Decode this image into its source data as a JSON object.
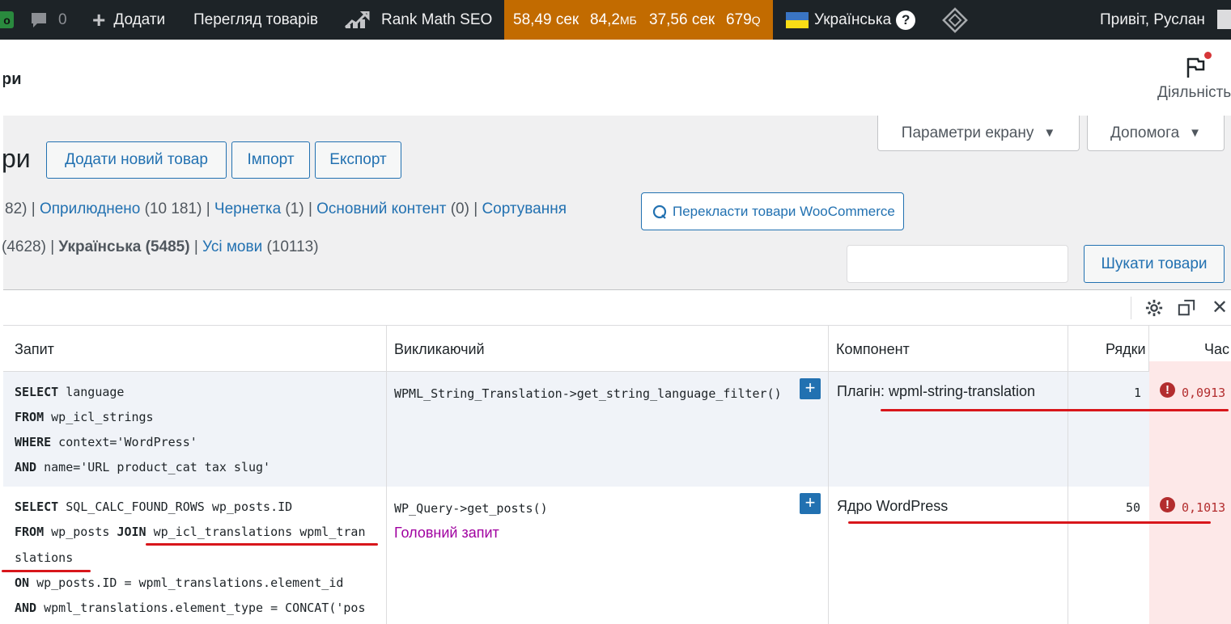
{
  "adminbar": {
    "cut_badge": "о",
    "comments_count": "0",
    "add_label": "Додати",
    "view_products": "Перегляд товарів",
    "rankmath": "Rank Math SEO",
    "qm": {
      "time": "58,49 сек",
      "memory": "84,2",
      "memory_unit": "МБ",
      "db_time": "37,56 сек",
      "queries": "679",
      "queries_unit": "Q"
    },
    "language": "Українська",
    "help_glyph": "?",
    "greeting": "Привіт, Руслан"
  },
  "header": {
    "title_fragment": "ри",
    "activity_label": "Діяльність",
    "accent_dot_color": "#d63638"
  },
  "screen_options": {
    "label": "Параметри екрану"
  },
  "help_tab": {
    "label": "Допомога"
  },
  "page": {
    "title_fragment": "ри",
    "add_new": "Додати новий товар",
    "import": "Імпорт",
    "export": "Експорт"
  },
  "status_filters": {
    "first_count": "82)",
    "published": "Оприлюднено",
    "published_count": "(10 181)",
    "draft": "Чернетка",
    "draft_count": "(1)",
    "cornerstone": "Основний контент",
    "cornerstone_count": "(0)",
    "sorting": "Сортування",
    "translate_button": "Перекласти товари WooCommerce"
  },
  "language_filters": {
    "first_count": "(4628)",
    "ukrainian": "Українська (5485)",
    "all": "Усі мови",
    "all_count": "(10113)"
  },
  "search": {
    "placeholder": "",
    "button": "Шукати товари"
  },
  "qm_table": {
    "columns": {
      "query": "Запит",
      "caller": "Викликаючий",
      "component": "Компонент",
      "rows": "Рядки",
      "time": "Час"
    },
    "rows": [
      {
        "sql": [
          {
            "kw": "SELECT",
            "rest": " language"
          },
          {
            "kw": "FROM",
            "rest": " wp_icl_strings"
          },
          {
            "kw": "WHERE",
            "rest": " context='WordPress'"
          },
          {
            "kw": "AND",
            "rest": " name='URL product_cat tax slug'"
          }
        ],
        "caller": "WPML_String_Translation->get_string_language_filter()",
        "caller_note": "",
        "component": "Плагін: wpml-string-translation",
        "rows": "1",
        "time": "0,0913"
      },
      {
        "sql": [
          {
            "kw": "SELECT",
            "rest": " SQL_CALC_FOUND_ROWS wp_posts.ID"
          },
          {
            "kw": "FROM",
            "rest": " wp_posts ",
            "kw2": "JOIN",
            "rest2": " wp_icl_translations wpml_tran"
          },
          {
            "kw": "",
            "rest": "slations"
          },
          {
            "kw": "ON",
            "rest": " wp_posts.ID = wpml_translations.element_id"
          },
          {
            "kw": "AND",
            "rest": " wpml_translations.element_type = CONCAT('pos"
          }
        ],
        "caller": "WP_Query->get_posts()",
        "caller_note": "Головний запит",
        "component": "Ядро WordPress",
        "rows": "50",
        "time": "0,1013"
      }
    ],
    "expand_glyph": "+",
    "warn_glyph": "!"
  },
  "colors": {
    "adminbar_bg": "#1d2327",
    "qm_highlight": "#c26b00",
    "link": "#2271b1",
    "error": "#b32d2e",
    "annotation": "#d8161b",
    "caller_note": "#a000a0"
  }
}
